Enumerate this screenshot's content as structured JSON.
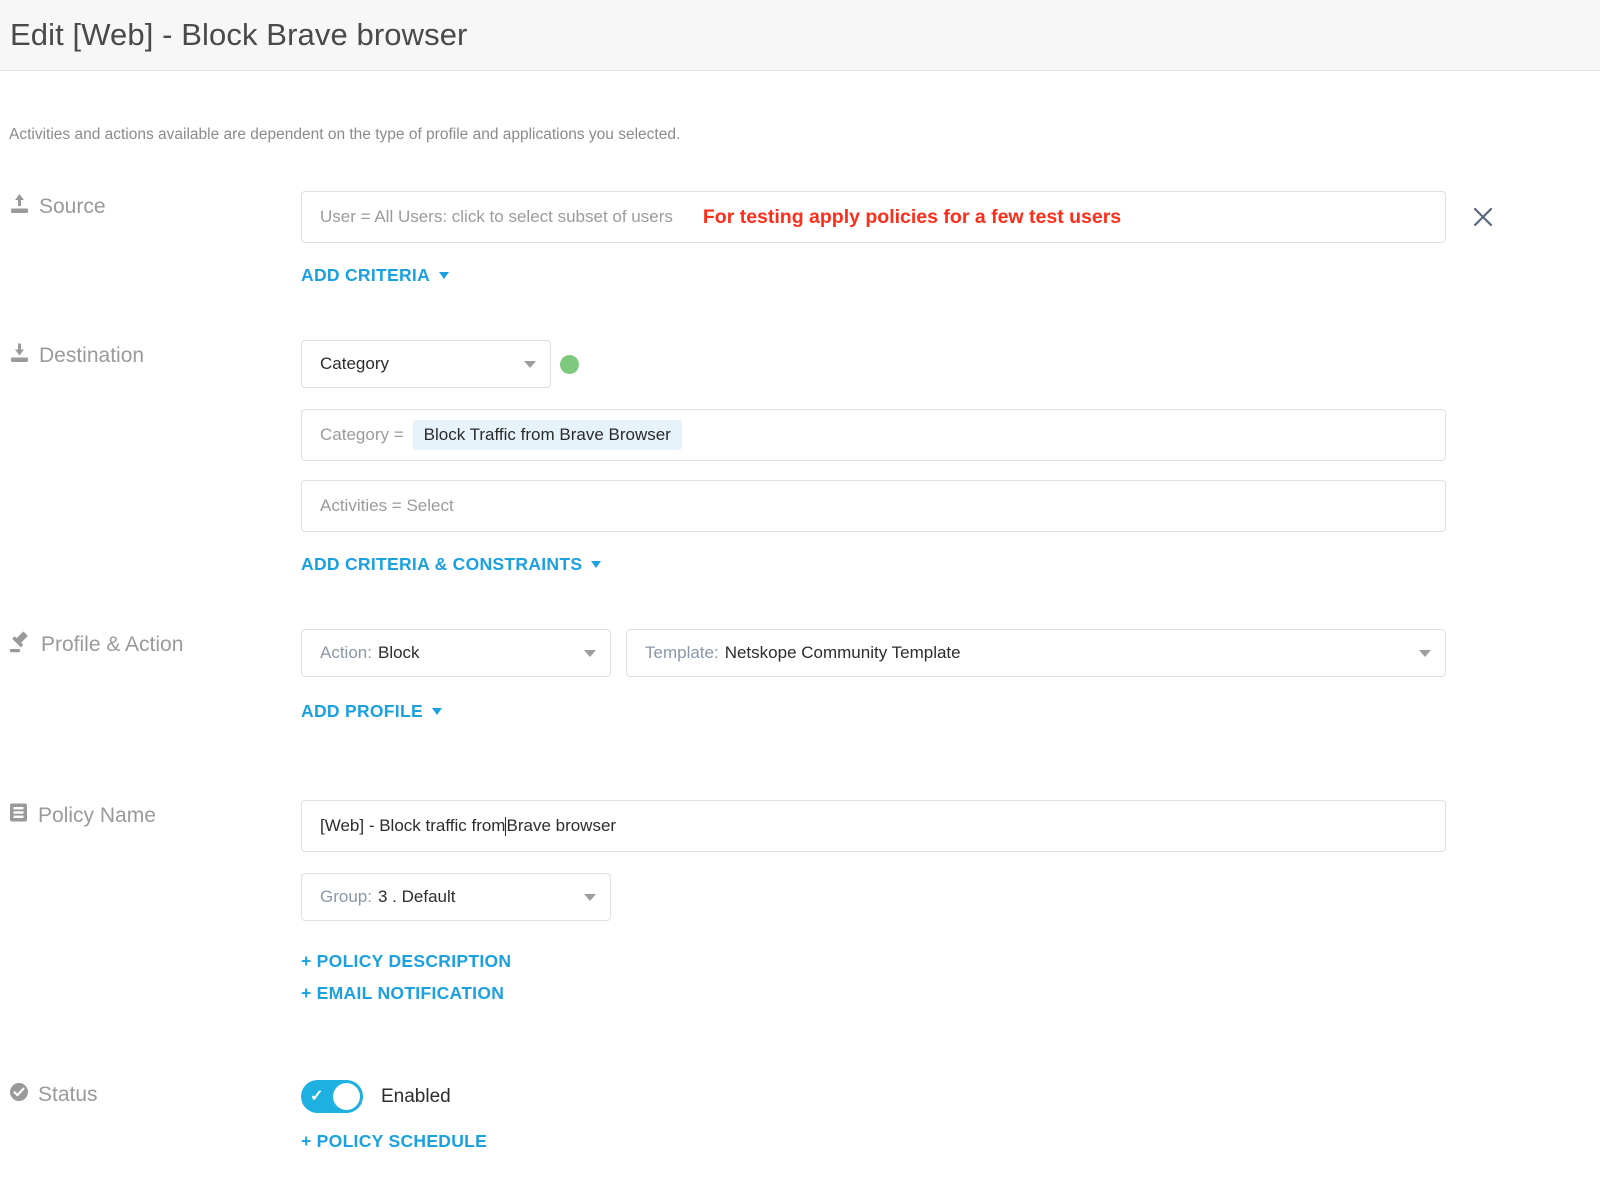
{
  "header": {
    "title": "Edit [Web] - Block Brave browser"
  },
  "intro": "Activities and actions available are dependent on the type of profile and applications you selected.",
  "source": {
    "label": "Source",
    "icon": "upload-icon",
    "criteria_text": "User = All Users: click to select subset of users",
    "annotation": "For testing apply policies for a few test users",
    "annotation_color": "#ff2d1a",
    "close_icon": "close-icon",
    "add_criteria_label": "ADD CRITERIA"
  },
  "destination": {
    "label": "Destination",
    "icon": "download-icon",
    "type_select": "Category",
    "status_dot_color": "#7fc97f",
    "category_prefix": "Category =",
    "category_value": "Block Traffic from Brave Browser",
    "activities_text": "Activities = Select",
    "add_criteria_label": "ADD CRITERIA & CONSTRAINTS"
  },
  "profile_action": {
    "label": "Profile & Action",
    "icon": "gavel-icon",
    "action_prefix": "Action:",
    "action_value": "Block",
    "template_prefix": "Template:",
    "template_value": "Netskope Community Template",
    "add_profile_label": "ADD PROFILE"
  },
  "policy_name": {
    "label": "Policy Name",
    "icon": "document-lines-icon",
    "name_before_cursor": "[Web] - Block traffic from ",
    "name_after_cursor": "Brave browser",
    "group_prefix": "Group:",
    "group_value": "3 . Default",
    "policy_description_label": "+ POLICY DESCRIPTION",
    "email_notification_label": "+ EMAIL NOTIFICATION"
  },
  "status": {
    "label": "Status",
    "icon": "check-circle-icon",
    "toggle_state": "Enabled",
    "toggle_color": "#1eb0e0",
    "policy_schedule_label": "+ POLICY SCHEDULE"
  }
}
